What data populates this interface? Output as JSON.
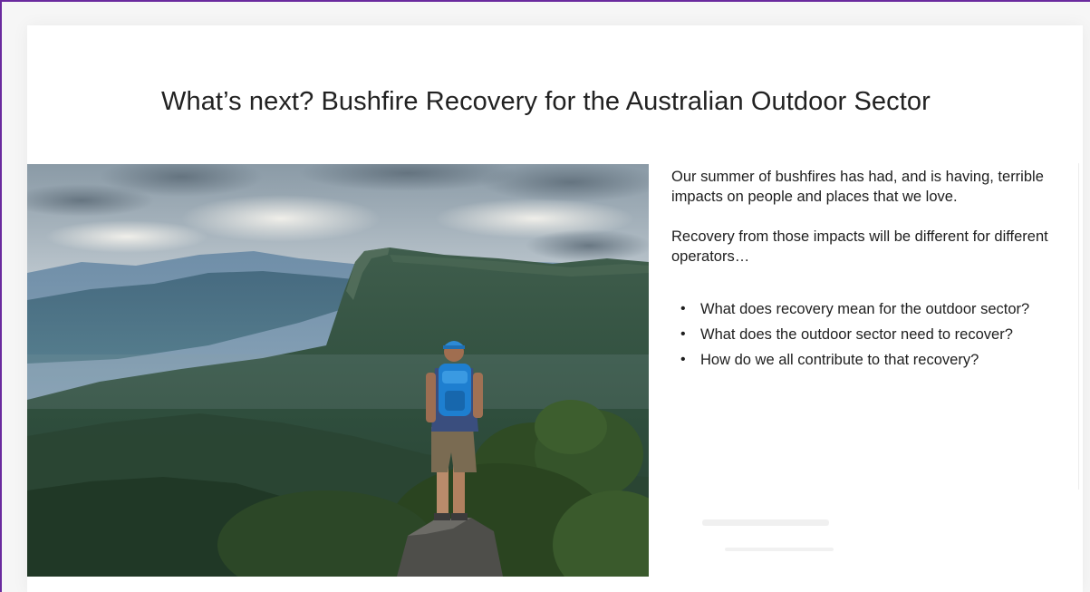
{
  "slide": {
    "title": "What’s next? Bushfire Recovery for the Australian Outdoor Sector",
    "paragraph_1": "Our summer of bushfires has had, and is having, terrible impacts on people and places that we love.",
    "paragraph_2": "Recovery from those impacts will be different for different operators…",
    "bullets": [
      "What does recovery mean for the outdoor sector?",
      "What does the outdoor sector need to recover?",
      "How do we all contribute to that recovery?"
    ],
    "bullet_glyph": "•",
    "image": "hiker-on-mountain-lookout-photo"
  },
  "colors": {
    "frame_border": "#6a2a9e",
    "text": "#1e1e1e"
  }
}
